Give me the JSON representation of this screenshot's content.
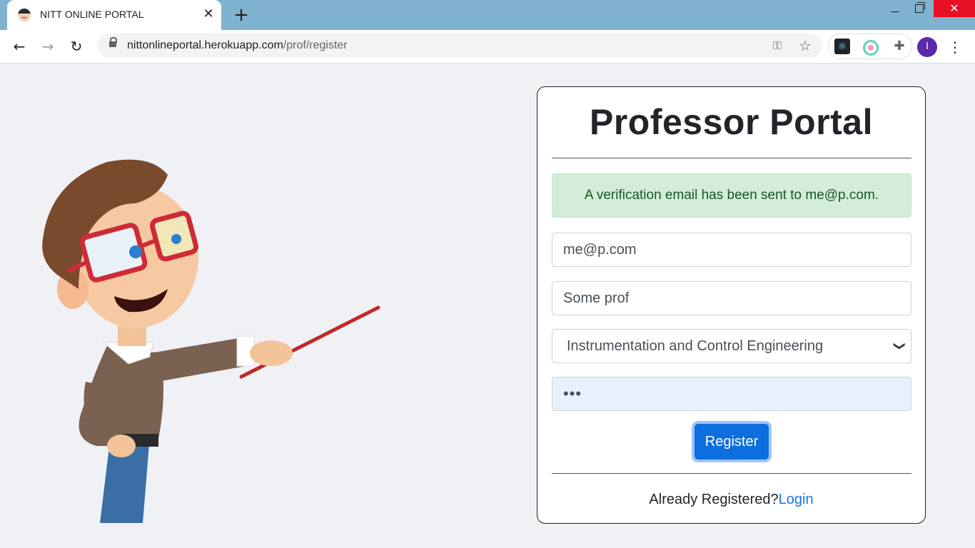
{
  "browser": {
    "tab_title": "NITT ONLINE PORTAL",
    "url_host": "nittonlineportal.herokuapp.com",
    "url_path": "/prof/register",
    "profile_initial": "I"
  },
  "page": {
    "title": "Professor Portal",
    "alert": "A verification email has been sent to me@p.com.",
    "email_value": "me@p.com",
    "name_value": "Some prof",
    "department_selected": "Instrumentation and Control Engineering",
    "password_masked": "•••",
    "register_label": "Register",
    "footer_text": "Already Registered?",
    "login_link": "Login"
  },
  "colors": {
    "accent": "#0d6ede",
    "alert_bg": "#d4edda",
    "alert_text": "#155724",
    "tabstrip": "#7fb3cf"
  }
}
